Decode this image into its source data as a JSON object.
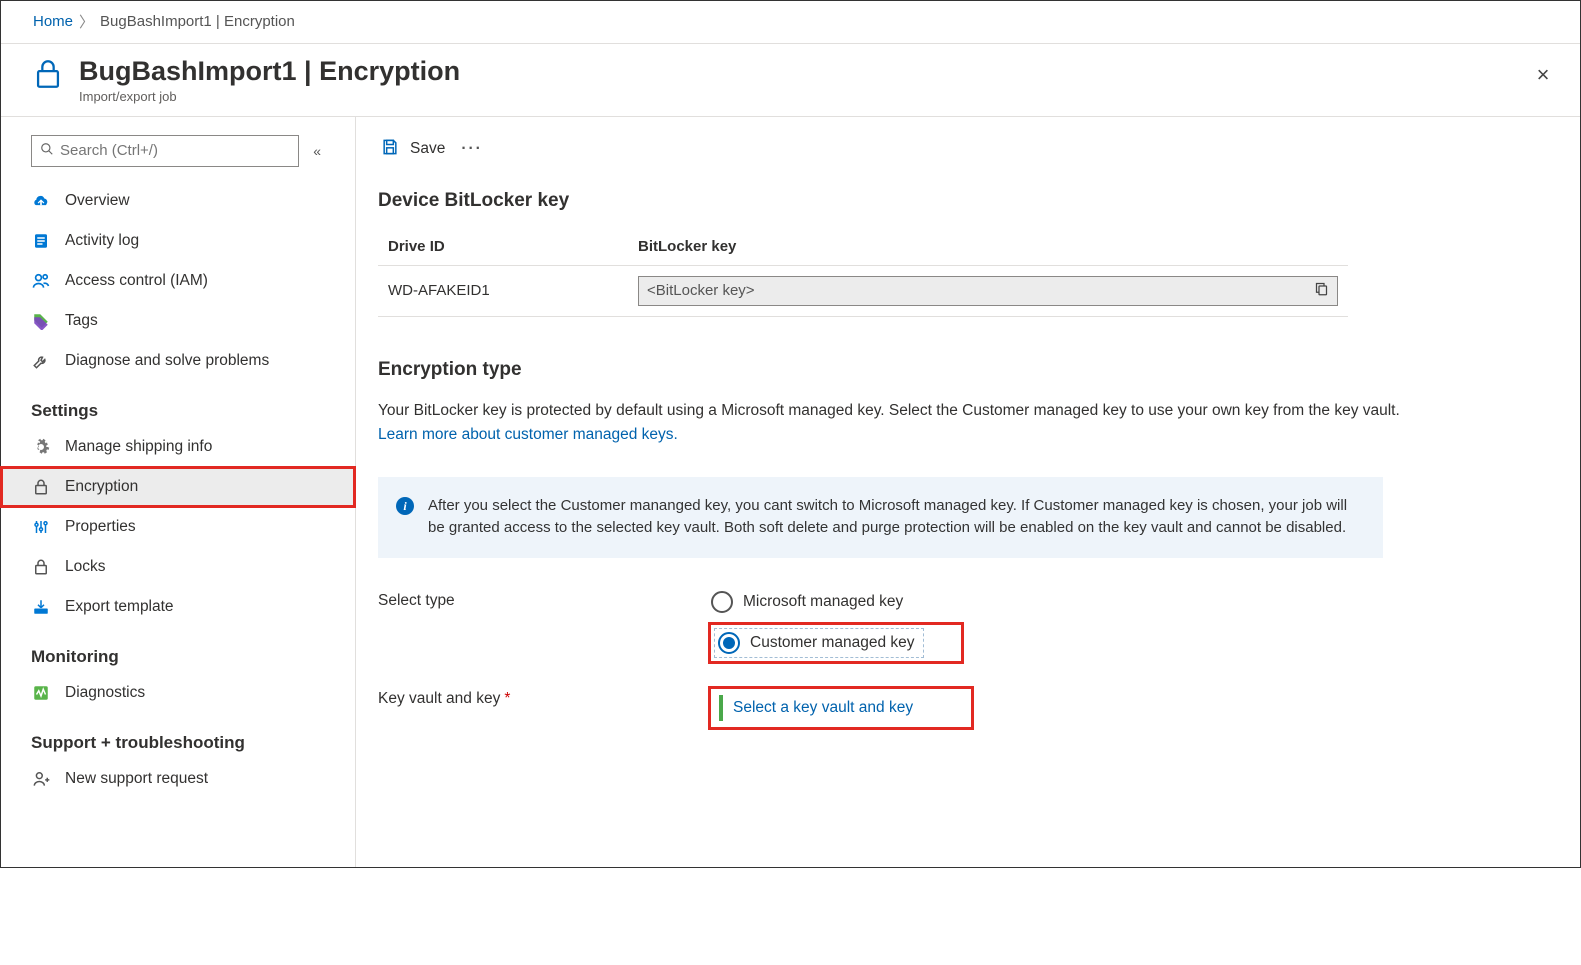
{
  "breadcrumb": {
    "home": "Home",
    "current": "BugBashImport1 | Encryption"
  },
  "header": {
    "title": "BugBashImport1 | Encryption",
    "subtitle": "Import/export job",
    "close": "×"
  },
  "sidebar": {
    "search_placeholder": "Search (Ctrl+/)",
    "items": {
      "overview": "Overview",
      "activity": "Activity log",
      "iam": "Access control (IAM)",
      "tags": "Tags",
      "diagnose": "Diagnose and solve problems"
    },
    "sections": {
      "settings": "Settings",
      "monitoring": "Monitoring",
      "support": "Support + troubleshooting"
    },
    "settings": {
      "shipping": "Manage shipping info",
      "encryption": "Encryption",
      "properties": "Properties",
      "locks": "Locks",
      "export": "Export template"
    },
    "monitoring": {
      "diagnostics": "Diagnostics"
    },
    "support": {
      "request": "New support request"
    }
  },
  "toolbar": {
    "save": "Save"
  },
  "bitlocker": {
    "heading": "Device BitLocker key",
    "col_drive": "Drive ID",
    "col_key": "BitLocker key",
    "drive_id": "WD-AFAKEID1",
    "key_value": "<BitLocker key>"
  },
  "encryption": {
    "heading": "Encryption type",
    "desc": "Your BitLocker key is protected by default using a Microsoft managed key. Select the Customer managed key to use your own key from the key vault.",
    "learn_link": "Learn more about customer managed keys.",
    "info": "After you select the Customer mananged key, you cant switch to Microsoft managed key. If Customer managed key is chosen, your job will be granted access to the selected key vault. Both soft delete and purge protection will be enabled on the key vault and cannot be disabled.",
    "select_label": "Select type",
    "opt_ms": "Microsoft managed key",
    "opt_cmk": "Customer managed key",
    "kv_label": "Key vault and key",
    "kv_link": "Select a key vault and key"
  }
}
